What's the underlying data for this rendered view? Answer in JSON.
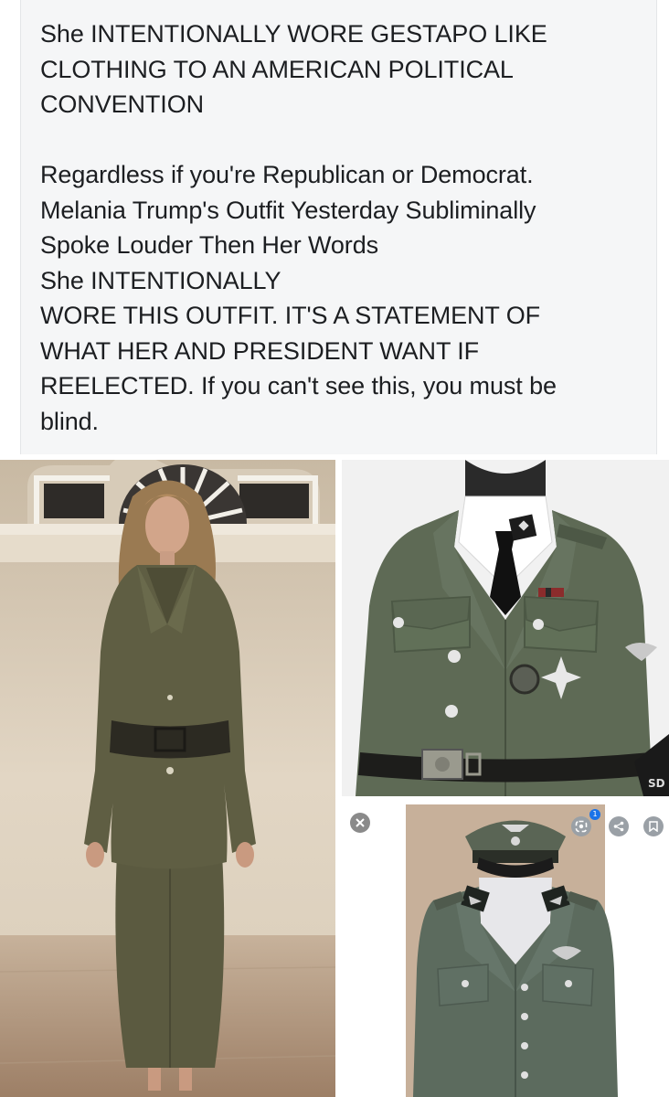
{
  "post": {
    "headline_lines": [
      "She INTENTIONALLY WORE GESTAPO  LIKE",
      "CLOTHING TO AN AMERICAN POLITICAL",
      "CONVENTION"
    ],
    "body_lines": [
      "Regardless if you're Republican or Democrat.",
      "Melania Trump's Outfit Yesterday Subliminally",
      "Spoke Louder Then Her Words",
      "She INTENTIONALLY",
      "WORE THIS OUTFIT. IT'S A STATEMENT OF",
      "WHAT HER AND PRESIDENT WANT IF",
      "REELECTED. If you can't see this,  you must be",
      "blind."
    ]
  },
  "images": {
    "bottom_right_controls": {
      "close_icon": "close-icon",
      "lens_icon": "lens-icon",
      "lens_badge": "1",
      "share_icon": "share-icon",
      "save_icon": "bookmark-icon"
    },
    "tunic_patch_text": "SD"
  },
  "colors": {
    "card_bg": "#f5f6f7",
    "text": "#1c1e21",
    "uniform_green": "#5e6a55",
    "dress_green": "#5b5a40"
  }
}
